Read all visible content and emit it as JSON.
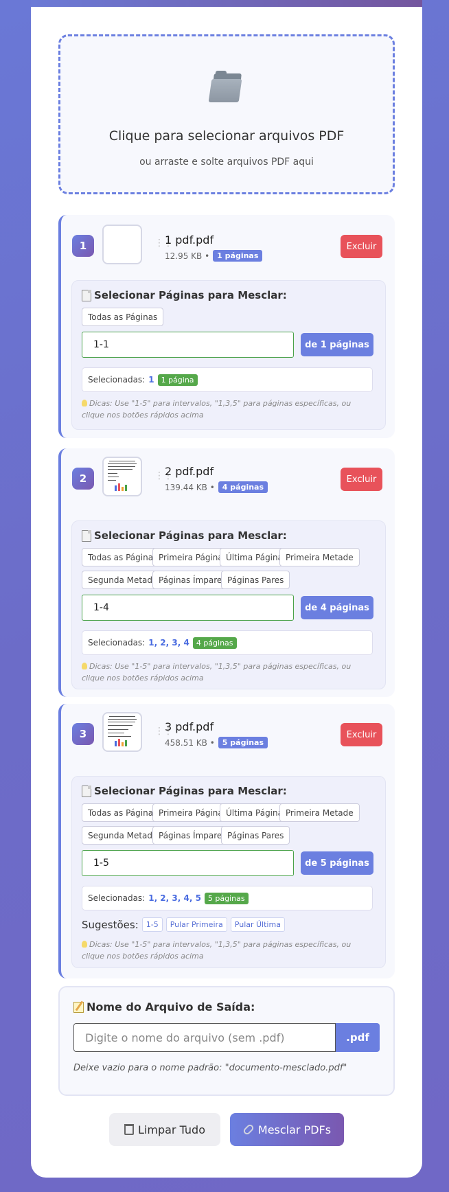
{
  "dropzone": {
    "title": "Clique para selecionar arquivos PDF",
    "subtitle": "ou arraste e solte arquivos PDF aqui",
    "icon": "folder-icon"
  },
  "files": [
    {
      "number": "1",
      "name": "1 pdf.pdf",
      "size": "12.95 KB •",
      "pages_badge": "1 páginas",
      "delete_label": "Excluir",
      "section_title": "Selecionar Páginas para Mesclar:",
      "quick_buttons": [
        "Todas as Páginas"
      ],
      "range_value": "1-1",
      "of_label": "de 1 páginas",
      "selected_label": "Selecionadas:",
      "selected_pages": "1",
      "selected_count": "1 página",
      "tips": "Dicas: Use \"1-5\" para intervalos, \"1,3,5\" para páginas específicas, ou clique nos botões rápidos acima"
    },
    {
      "number": "2",
      "name": "2 pdf.pdf",
      "size": "139.44 KB •",
      "pages_badge": "4 páginas",
      "delete_label": "Excluir",
      "section_title": "Selecionar Páginas para Mesclar:",
      "quick_buttons": [
        "Todas as Páginas",
        "Primeira Página",
        "Última Página",
        "Primeira Metade",
        "Segunda Metade",
        "Páginas Ímpares",
        "Páginas Pares"
      ],
      "range_value": "1-4",
      "of_label": "de 4 páginas",
      "selected_label": "Selecionadas:",
      "selected_pages": "1, 2, 3, 4",
      "selected_count": "4 páginas",
      "tips": "Dicas: Use \"1-5\" para intervalos, \"1,3,5\" para páginas específicas, ou clique nos botões rápidos acima"
    },
    {
      "number": "3",
      "name": "3 pdf.pdf",
      "size": "458.51 KB •",
      "pages_badge": "5 páginas",
      "delete_label": "Excluir",
      "section_title": "Selecionar Páginas para Mesclar:",
      "quick_buttons": [
        "Todas as Páginas",
        "Primeira Página",
        "Última Página",
        "Primeira Metade",
        "Segunda Metade",
        "Páginas Ímpares",
        "Páginas Pares"
      ],
      "range_value": "1-5",
      "of_label": "de 5 páginas",
      "selected_label": "Selecionadas:",
      "selected_pages": "1, 2, 3, 4, 5",
      "selected_count": "5 páginas",
      "suggestions_label": "Sugestões:",
      "suggestions": [
        "1-5",
        "Pular Primeira",
        "Pular Última"
      ],
      "tips": "Dicas: Use \"1-5\" para intervalos, \"1,3,5\" para páginas específicas, ou clique nos botões rápidos acima"
    }
  ],
  "output": {
    "title": "Nome do Arquivo de Saída:",
    "placeholder": "Digite o nome do arquivo (sem .pdf)",
    "suffix": ".pdf",
    "hint": "Deixe vazio para o nome padrão: \"documento-mesclado.pdf\""
  },
  "actions": {
    "clear_label": "Limpar Tudo",
    "merge_label": "Mesclar PDFs"
  },
  "colors": {
    "accent": "#6b7fe0",
    "danger": "#e8525a",
    "success": "#55a84a"
  }
}
